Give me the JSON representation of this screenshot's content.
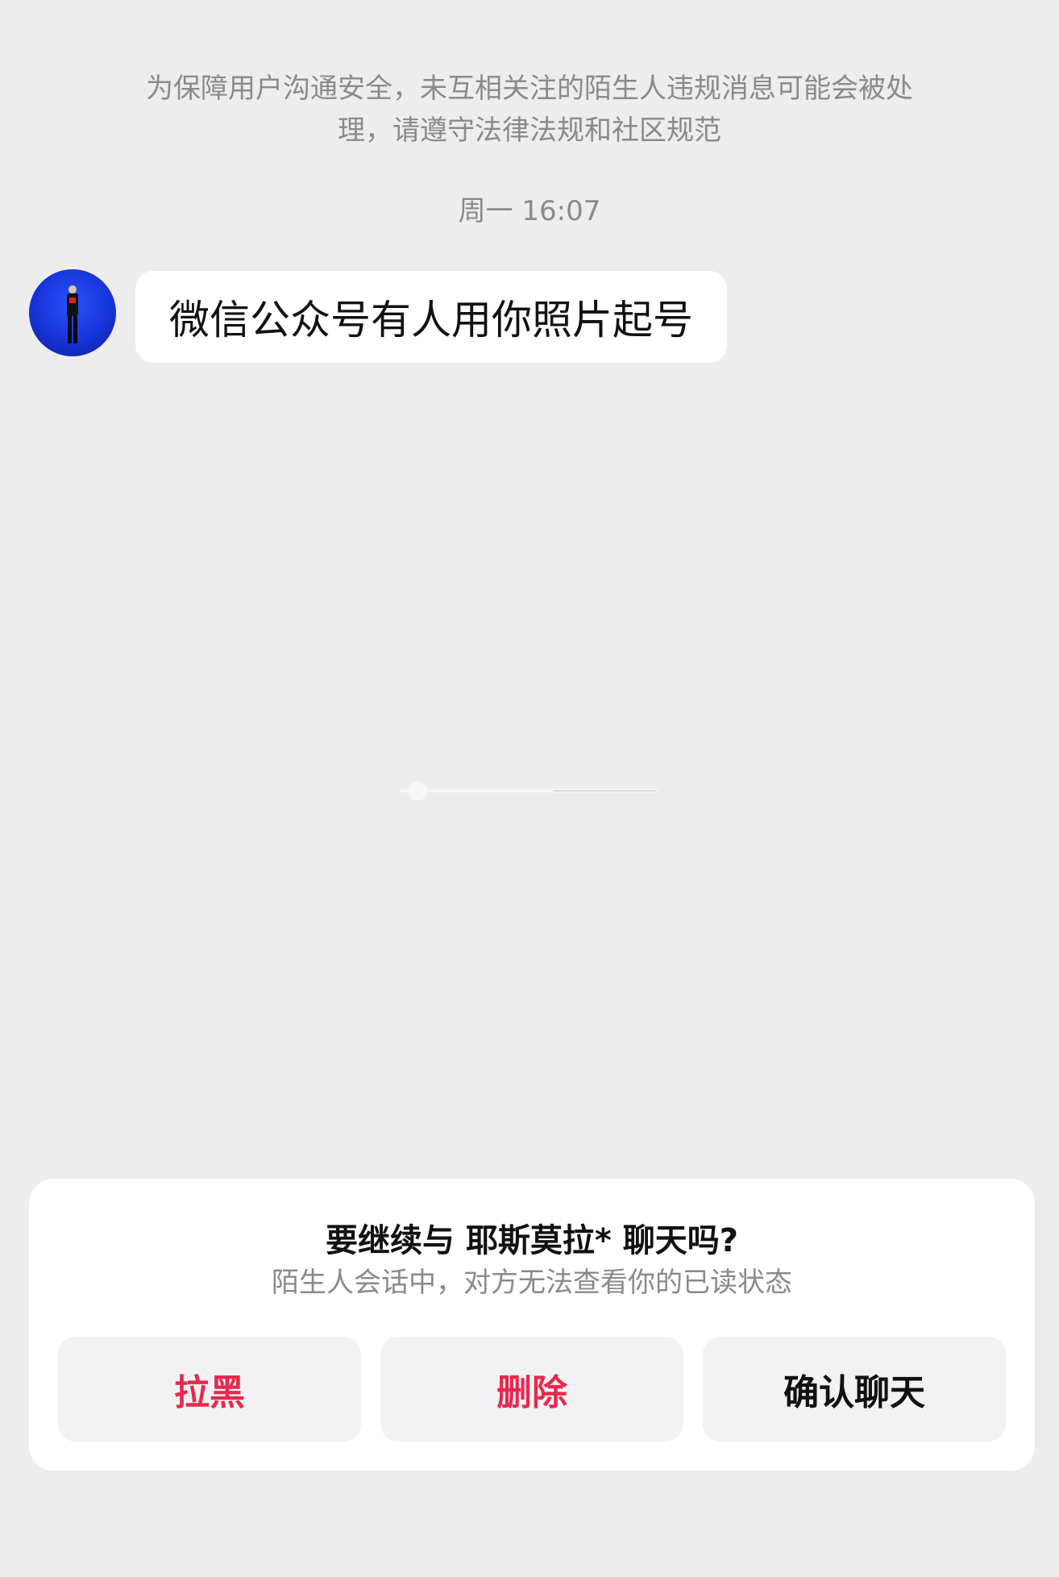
{
  "notice": {
    "line1": "为保障用户沟通安全，未互相关注的陌生人违规消息可能会被处",
    "line2": "理，请遵守法律法规和社区规范"
  },
  "timestamp": "周一 16:07",
  "message": {
    "text": "微信公众号有人用你照片起号"
  },
  "dialog": {
    "title": "要继续与 耶斯莫拉* 聊天吗?",
    "subtitle": "陌生人会话中，对方无法查看你的已读状态",
    "buttons": {
      "block": "拉黑",
      "delete": "删除",
      "confirm": "确认聊天"
    }
  },
  "colors": {
    "background": "#ededed",
    "danger": "#e8284d",
    "muted_text": "#8a8a8a",
    "avatar_bg": "#1634d8"
  },
  "icons": {
    "avatar": "user-avatar-photo",
    "loader": "loading-spinner"
  }
}
